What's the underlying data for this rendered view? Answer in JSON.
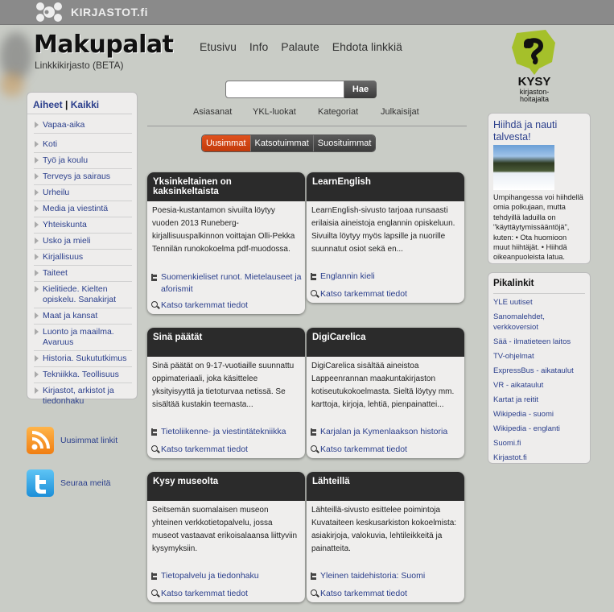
{
  "topbar": {
    "brand": "KIRJASTOT.fi"
  },
  "header": {
    "title": "Makupalat",
    "subtitle": "Linkkikirjasto (BETA)"
  },
  "nav": {
    "items": [
      "Etusivu",
      "Info",
      "Palaute",
      "Ehdota linkkiä"
    ]
  },
  "search": {
    "value": "",
    "placeholder": "",
    "button": "Hae"
  },
  "browse": {
    "items": [
      "Asiasanat",
      "YKL-luokat",
      "Kategoriat",
      "Julkaisijat"
    ]
  },
  "sort_tabs": {
    "items": [
      "Uusimmat",
      "Katsotuimmat",
      "Suosituimmat"
    ],
    "active": "Uusimmat"
  },
  "colors": {
    "accent": "#d2460f",
    "link": "#2b3f8c",
    "card_header": "#2b2b2b",
    "kysy_green": "#a5c02a"
  },
  "left_panel": {
    "header_a": "Aiheet",
    "separator": "|",
    "header_b": "Kaikki",
    "items": [
      "Vapaa-aika",
      "Koti",
      "Työ ja koulu",
      "Terveys ja sairaus",
      "Urheilu",
      "Media ja viestintä",
      "Yhteiskunta",
      "Usko ja mieli",
      "Kirjallisuus",
      "Taiteet",
      "Kielitiede. Kielten opiskelu. Sanakirjat",
      "Maat ja kansat",
      "Luonto ja maailma. Avaruus",
      "Historia. Sukututkimus",
      "Tekniikka. Teollisuus",
      "Kirjastot, arkistot ja tiedonhaku"
    ]
  },
  "social": {
    "rss_label": "Uusimmat linkit",
    "twitter_label": "Seuraa meitä"
  },
  "cards": [
    {
      "title": "Yksinkeltainen on kaksinkeltaista",
      "body": "Poesia-kustantamon sivuilta löytyy vuoden 2013 Runeberg-kirjallisuuspalkinnon voittajan Olli-Pekka Tennilän runokokoelma pdf-muodossa.",
      "category": "Suomenkieliset runot. Mietelauseet ja aforismit",
      "more": "Katso tarkemmat tiedot"
    },
    {
      "title": "LearnEnglish",
      "body": "LearnEnglish-sivusto tarjoaa runsaasti erilaisia aineistoja englannin opiskeluun. Sivuilta löytyy myös lapsille ja nuorille suunnatut osiot sekä en...",
      "category": "Englannin kieli",
      "more": "Katso tarkemmat tiedot"
    },
    {
      "title": "Sinä päätät",
      "body": "Sinä päätät on 9-17-vuotiaille suunnattu oppimateriaali, joka käsittelee yksityisyyttä ja tietoturvaa netissä. Se sisältää kustakin teemasta...",
      "category": "Tietoliikenne- ja viestintätekniikka",
      "more": "Katso tarkemmat tiedot"
    },
    {
      "title": "DigiCarelica",
      "body": "DigiCarelica sisältää aineistoa Lappeenrannan maakuntakirjaston kotiseutukokoelmasta. Sieltä löytyy mm. karttoja, kirjoja, lehtiä, pienpainattei...",
      "category": "Karjalan ja Kymenlaakson historia",
      "more": "Katso tarkemmat tiedot"
    },
    {
      "title": "Kysy museolta",
      "body": "Seitsemän suomalaisen museon yhteinen verkkotietopalvelu, jossa museot vastaavat erikoisalaansa liittyviin kysymyksiin.",
      "category": "Tietopalvelu ja tiedonhaku",
      "more": "Katso tarkemmat tiedot"
    },
    {
      "title": "Lähteillä",
      "body": "Lähteillä-sivusto esittelee poimintoja Kuvataiteen keskusarkiston kokoelmista: asiakirjoja, valokuvia, lehtileikkeitä ja painatteita.",
      "category": "Yleinen taidehistoria: Suomi",
      "more": "Katso tarkemmat tiedot"
    }
  ],
  "kysy": {
    "line1": "KYSY",
    "line2": "kirjaston-",
    "line3": "hoitajalta"
  },
  "promo": {
    "title": "Hiihdä ja nauti talvesta!",
    "text": "Umpihangessa voi hiihdellä omia polkujaan, mutta tehdyillä laduilla on \"käyttäytymissääntöjä\", kuten: • Ota huomioon muut hiihtäjät. • Hiihdä oikeanpuoleista latua."
  },
  "quicklinks": {
    "title": "Pikalinkit",
    "items": [
      "YLE uutiset",
      "Sanomalehdet, verkkoversiot",
      "Sää - ilmatieteen laitos",
      "TV-ohjelmat",
      "ExpressBus - aikataulut",
      "VR - aikataulut",
      "Kartat ja reitit",
      "Wikipedia - suomi",
      "Wikipedia - englanti",
      "Suomi.fi",
      "Kirjastot.fi"
    ]
  }
}
